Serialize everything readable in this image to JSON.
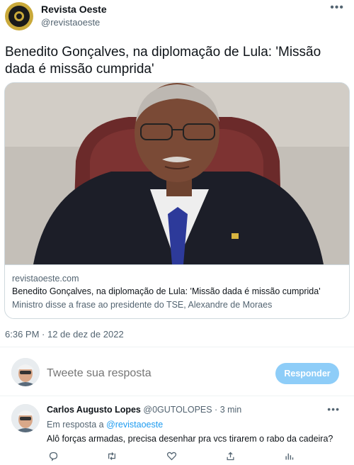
{
  "author": {
    "display_name": "Revista Oeste",
    "handle": "@revistaoeste"
  },
  "tweet": {
    "text": "Benedito Gonçalves, na diplomação de Lula: 'Missão dada é missão cumprida'",
    "timestamp": "6:36 PM · 12 de dez de 2022"
  },
  "card": {
    "domain": "revistaoeste.com",
    "title": "Benedito Gonçalves, na diplomação de Lula: 'Missão dada é missão cumprida'",
    "description": "Ministro disse a frase ao presidente do TSE, Alexandre de Moraes"
  },
  "reply_box": {
    "placeholder": "Tweete sua resposta",
    "button_label": "Responder"
  },
  "reply": {
    "name": "Carlos Augusto Lopes",
    "handle_time": "@0GUTOLOPES · 3 min",
    "reply_to_prefix": "Em resposta a ",
    "reply_to_handle": "@revistaoeste",
    "text": "Alô forças armadas, precisa desenhar pra vcs tirarem o rabo da cadeira?"
  },
  "icons": {
    "more": "more-horizontal-icon",
    "reply": "comment-icon",
    "retweet": "retweet-icon",
    "like": "heart-icon",
    "analytics": "analytics-icon"
  },
  "colors": {
    "accent": "#1d9bf0",
    "button_disabled": "#8ecdf8",
    "secondary_text": "#536471"
  }
}
